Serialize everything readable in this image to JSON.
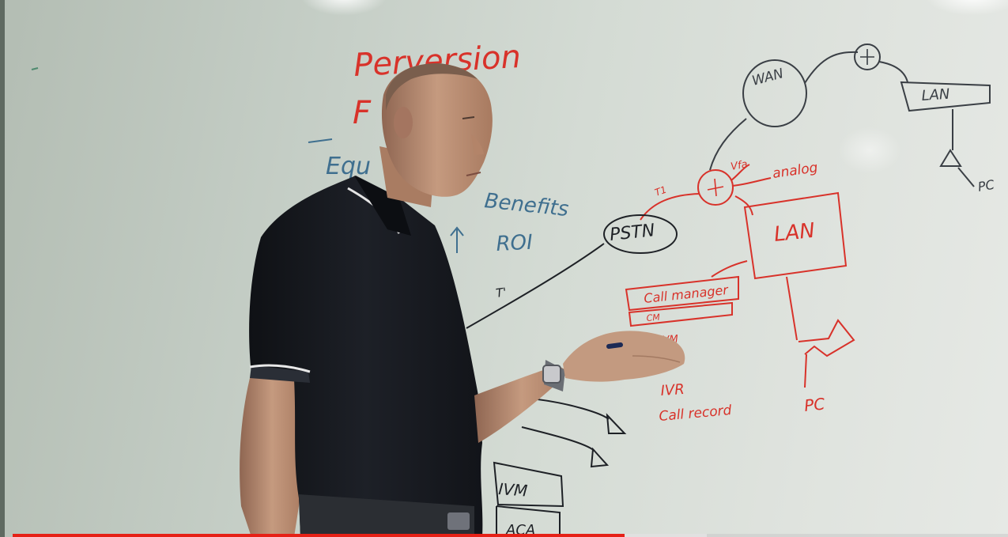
{
  "video": {
    "progress_fraction": 0.6145,
    "buffered_fraction": 0.697
  },
  "whiteboard": {
    "left_words": [
      "Perversion",
      "F",
      "Equ",
      "Benefits",
      "ROI",
      "T'"
    ],
    "center_labels": [
      "PSTN"
    ],
    "red_labels": [
      "Vfa",
      "analog",
      "T1",
      "LAN",
      "Call manager",
      "CM",
      "VM",
      "IVR",
      "Call record",
      "PC"
    ],
    "upper_right_labels": [
      "WAN",
      "LAN",
      "PC"
    ],
    "lower_labels": [
      "IVM",
      "ACA"
    ]
  },
  "colors": {
    "marker_red": "#d8322a",
    "marker_blue": "#3f6f8f",
    "marker_black": "#1e2126",
    "shirt": "#15171c",
    "skin": "#b98a6f",
    "progress_played": "#e62117"
  }
}
